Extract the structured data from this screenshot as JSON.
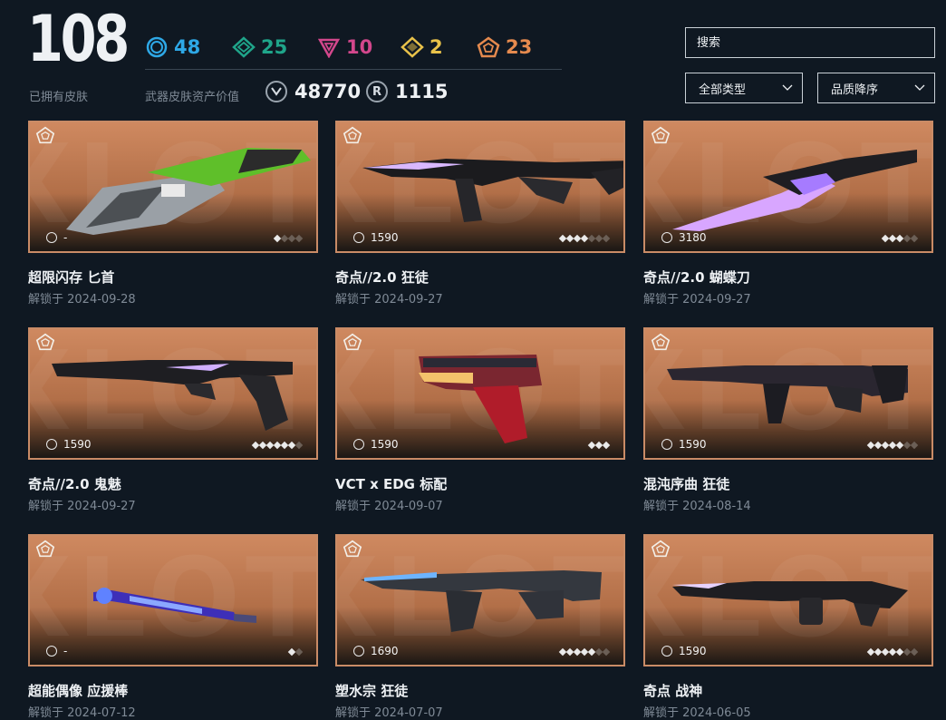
{
  "header": {
    "skin_count": "108",
    "skin_count_label": "已拥有皮肤",
    "tier_counts": [
      {
        "name": "select-icon",
        "value": "48",
        "color": "#2ea8e6"
      },
      {
        "name": "deluxe-icon",
        "value": "25",
        "color": "#1fa58a"
      },
      {
        "name": "premium-icon",
        "value": "10",
        "color": "#d3478c"
      },
      {
        "name": "exclusive-icon",
        "value": "2",
        "color": "#e9c24a"
      },
      {
        "name": "ultra-icon",
        "value": "23",
        "color": "#e58a4e"
      }
    ],
    "asset_label": "武器皮肤资产价值",
    "vp_value": "48770",
    "vp_icon_glyph": "",
    "radianite_value": "1115",
    "radianite_glyph": "R"
  },
  "controls": {
    "search_placeholder": "搜索",
    "type_select": "全部类型",
    "sort_select": "品质降序"
  },
  "skins": [
    {
      "name": "超限闪存 匕首",
      "date": "解锁于 2024-09-28",
      "price": "-",
      "dots_on": 1,
      "dots_total": 4
    },
    {
      "name": "奇点//2.0 狂徒",
      "date": "解锁于 2024-09-27",
      "price": "1590",
      "dots_on": 4,
      "dots_total": 7
    },
    {
      "name": "奇点//2.0 蝴蝶刀",
      "date": "解锁于 2024-09-27",
      "price": "3180",
      "dots_on": 3,
      "dots_total": 5
    },
    {
      "name": "奇点//2.0 鬼魅",
      "date": "解锁于 2024-09-27",
      "price": "1590",
      "dots_on": 6,
      "dots_total": 7
    },
    {
      "name": "VCT x EDG 标配",
      "date": "解锁于 2024-09-07",
      "price": "1590",
      "dots_on": 3,
      "dots_total": 3
    },
    {
      "name": "混沌序曲 狂徒",
      "date": "解锁于 2024-08-14",
      "price": "1590",
      "dots_on": 5,
      "dots_total": 7
    },
    {
      "name": "超能偶像 应援棒",
      "date": "解锁于 2024-07-12",
      "price": "-",
      "dots_on": 1,
      "dots_total": 2
    },
    {
      "name": "塑水宗 狂徒",
      "date": "解锁于 2024-07-07",
      "price": "1690",
      "dots_on": 5,
      "dots_total": 7
    },
    {
      "name": "奇点 战神",
      "date": "解锁于 2024-06-05",
      "price": "1590",
      "dots_on": 5,
      "dots_total": 7
    }
  ],
  "colors": {
    "card_border": "#c98b66",
    "card_top": "#cf8960",
    "background": "#0f1822"
  }
}
